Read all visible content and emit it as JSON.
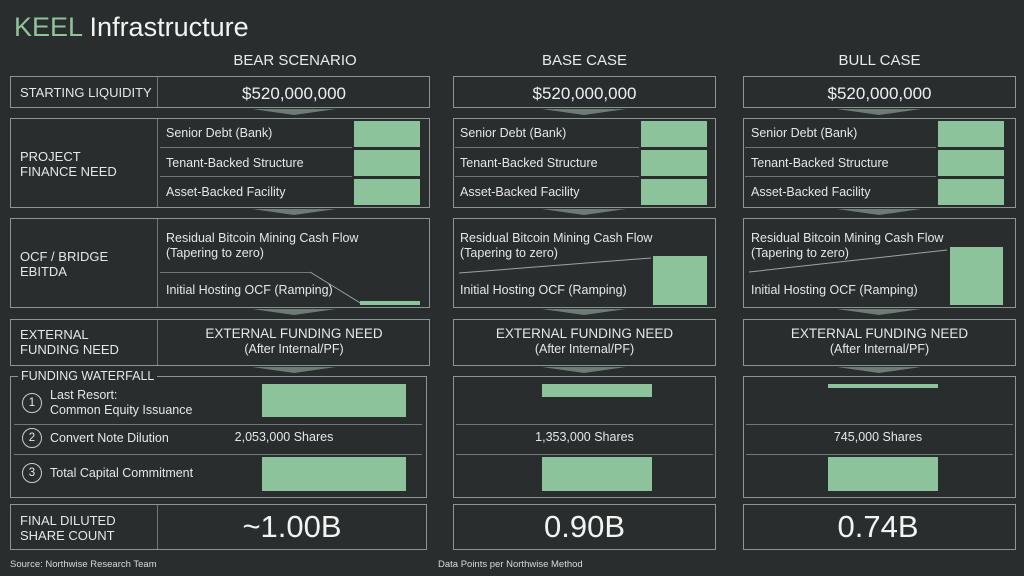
{
  "title": {
    "brand": "KEEL",
    "rest": " Infrastructure"
  },
  "columns": [
    "BEAR SCENARIO",
    "BASE CASE",
    "BULL CASE"
  ],
  "rows": {
    "starting_liquidity": "STARTING LIQUIDITY",
    "project_finance": "PROJECT\nFINANCE NEED",
    "ocf_bridge": "OCF / BRIDGE\nEBITDA",
    "external_funding": "EXTERNAL\nFUNDING NEED",
    "funding_waterfall": "FUNDING WATERFALL",
    "final_share": "FINAL DILUTED\nSHARE COUNT"
  },
  "starting_liquidity_values": [
    "$520,000,000",
    "$520,000,000",
    "$520,000,000"
  ],
  "project_finance_items": [
    "Senior Debt (Bank)",
    "Tenant-Backed Structure",
    "Asset-Backed Facility"
  ],
  "ocf": {
    "residual_line1": "Residual Bitcoin Mining Cash Flow",
    "residual_line2": "(Tapering to zero)",
    "initial": "Initial Hosting OCF (Ramping)"
  },
  "external_funding_box": {
    "line1": "EXTERNAL FUNDING NEED",
    "line2": "(After Internal/PF)"
  },
  "waterfall": {
    "steps": [
      {
        "num": "1",
        "label_line1": "Last Resort:",
        "label_line2": "Common Equity Issuance"
      },
      {
        "num": "2",
        "label_line1": "Convert Note Dilution",
        "label_line2": ""
      },
      {
        "num": "3",
        "label_line1": "Total Capital Commitment",
        "label_line2": ""
      }
    ],
    "shares": [
      "2,053,000 Shares",
      "1,353,000 Shares",
      "745,000 Shares"
    ]
  },
  "final_share_counts": [
    "~1.00B",
    "0.90B",
    "0.74B"
  ],
  "footer": {
    "source": "Source: Northwise Research Team",
    "data_points": "Data Points per Northwise Method"
  },
  "colors": {
    "background": "#2a2d2e",
    "accent_green": "#8cc39a",
    "border": "#8a9690"
  }
}
